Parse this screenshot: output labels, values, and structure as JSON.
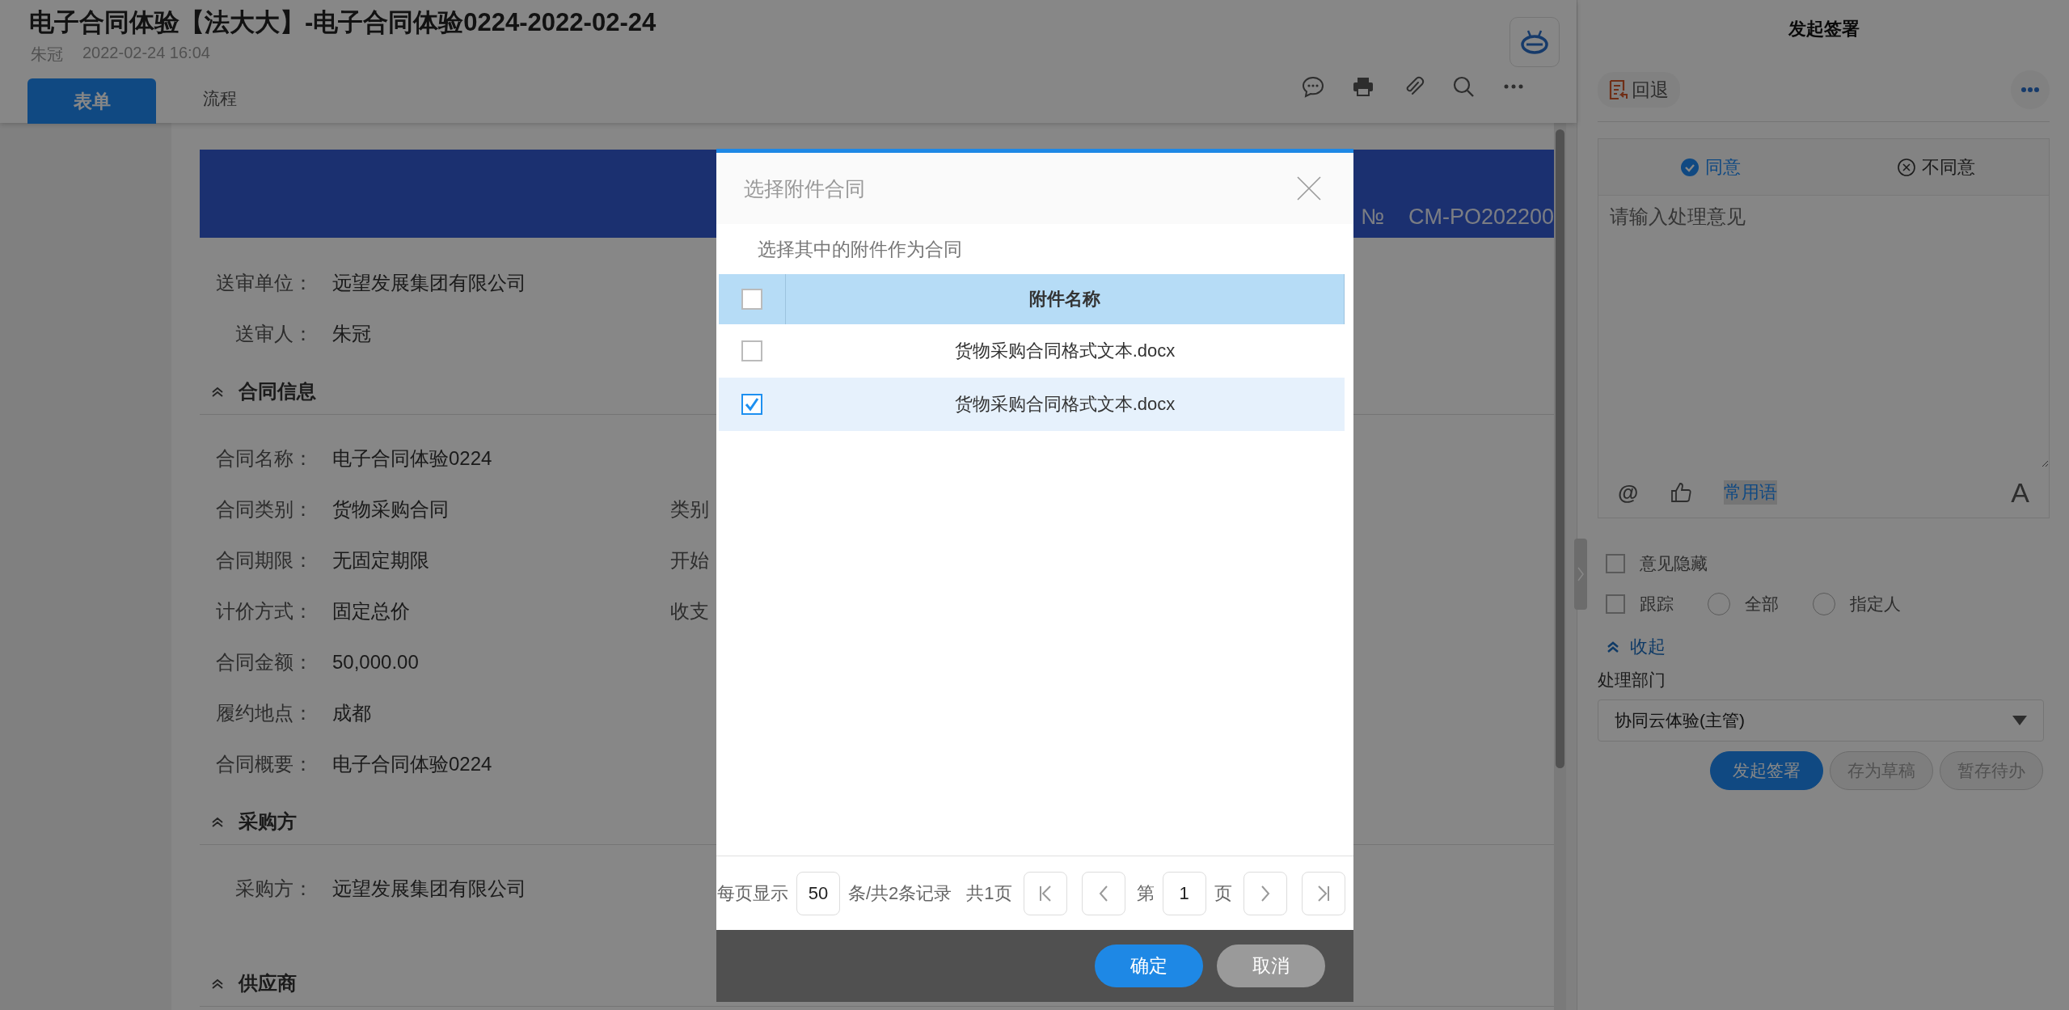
{
  "header": {
    "title": "电子合同体验【法大大】-电子合同体验0224-2022-02-24",
    "author": "朱冠",
    "time": "2022-02-24 16:04",
    "tabs": [
      {
        "label": "表单",
        "selected": true
      },
      {
        "label": "流程",
        "selected": false
      }
    ]
  },
  "document": {
    "number_mark": "№",
    "number": "CM-PO202200",
    "blocks": [
      {
        "kind": "field",
        "label": "送审单位：",
        "value": "远望发展集团有限公司"
      },
      {
        "kind": "field",
        "label": "送审人：",
        "value": "朱冠"
      },
      {
        "kind": "section",
        "label": "合同信息"
      },
      {
        "kind": "field",
        "label": "合同名称：",
        "value": "电子合同体验0224"
      },
      {
        "kind": "field",
        "label": "合同类别：",
        "value": "货物采购合同",
        "side_label": "类别"
      },
      {
        "kind": "field",
        "label": "合同期限：",
        "value": "无固定期限",
        "side_label": "开始"
      },
      {
        "kind": "field",
        "label": "计价方式：",
        "value": "固定总价",
        "side_label": "收支"
      },
      {
        "kind": "field",
        "label": "合同金额：",
        "value": "50,000.00"
      },
      {
        "kind": "field",
        "label": "履约地点：",
        "value": "成都"
      },
      {
        "kind": "field",
        "label": "合同概要：",
        "value": "电子合同体验0224"
      },
      {
        "kind": "section",
        "label": "采购方"
      },
      {
        "kind": "field",
        "label": "采购方：",
        "value": "远望发展集团有限公司"
      },
      {
        "kind": "section",
        "label": "供应商"
      }
    ]
  },
  "sign_panel": {
    "title": "发起签署",
    "back_label": "回退",
    "opinion_tabs": [
      {
        "label": "同意",
        "selected": true
      },
      {
        "label": "不同意",
        "selected": false
      }
    ],
    "opinion_placeholder": "请输入处理意见",
    "at_label": "@",
    "phrases_label": "常用语",
    "font_label": "A",
    "option_rows": [
      {
        "items": [
          {
            "kind": "checkbox",
            "label": "意见隐藏",
            "checked": false
          }
        ]
      },
      {
        "items": [
          {
            "kind": "checkbox",
            "label": "跟踪",
            "checked": false
          },
          {
            "kind": "radio",
            "label": "全部",
            "selected": false
          },
          {
            "kind": "radio",
            "label": "指定人",
            "selected": false
          }
        ]
      }
    ],
    "collapse_label": "收起",
    "department_label": "处理部门",
    "department": "协同云体验(主管)",
    "actions": [
      {
        "label": "发起签署",
        "kind": "primary"
      },
      {
        "label": "存为草稿",
        "kind": "secondary"
      },
      {
        "label": "暂存待办",
        "kind": "secondary"
      }
    ]
  },
  "dialog": {
    "title": "选择附件合同",
    "subtitle": "选择其中的附件作为合同",
    "column": "附件名称",
    "header_checked": false,
    "rows": [
      {
        "name": "货物采购合同格式文本.docx",
        "checked": false,
        "selected": false
      },
      {
        "name": "货物采购合同格式文本.docx",
        "checked": true,
        "selected": true
      }
    ],
    "pagination": {
      "per_page_label": "每页显示",
      "per_page": "50",
      "records": "条/共2条记录",
      "pages": "共1页",
      "page_prefix": "第",
      "page": "1",
      "page_suffix": "页"
    },
    "buttons": [
      {
        "label": "确定",
        "kind": "primary"
      },
      {
        "label": "取消",
        "kind": "secondary"
      }
    ]
  }
}
